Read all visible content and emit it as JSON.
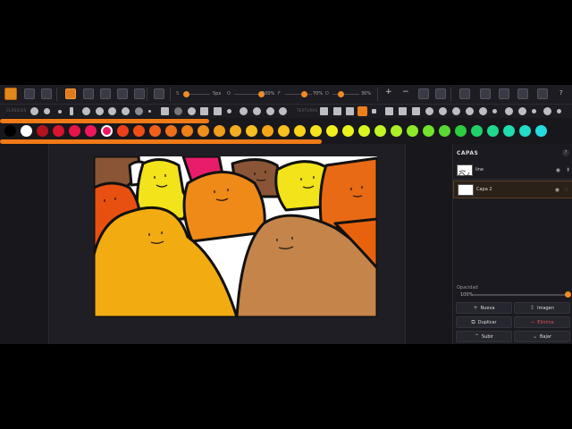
{
  "toolbar": {
    "sliders": [
      {
        "label": "S",
        "value": "5px",
        "fill": 0.1
      },
      {
        "label": "O",
        "value": "100%",
        "fill": 1.0
      },
      {
        "label": "F",
        "value": "70%",
        "fill": 0.7
      },
      {
        "label": "D",
        "value": "30%",
        "fill": 0.3
      }
    ],
    "help": "?"
  },
  "brushbar": {
    "section_brushes": "CLÁSICOS",
    "section_textures": "TEXTURAS",
    "accent": "#f07a16"
  },
  "palette": {
    "colors": [
      "#000000",
      "#ffffff",
      "#b3121c",
      "#d8142f",
      "#e8134a",
      "#f0165e",
      "#f01860",
      "#ef3f1a",
      "#ef4e14",
      "#f0601a",
      "#f0701a",
      "#f07f16",
      "#f08f1c",
      "#f29c1c",
      "#f4ac20",
      "#f7be24",
      "#f5a418",
      "#f7bf20",
      "#f7d218",
      "#f6e21c",
      "#f3ee1e",
      "#eaf31c",
      "#d7f51e",
      "#c2f326",
      "#aaf028",
      "#8ee82a",
      "#74e22c",
      "#5ad834",
      "#2ecc40",
      "#22d06a",
      "#20d88e",
      "#20dcae",
      "#22dcc8",
      "#24dce0"
    ],
    "selected_index": 6
  },
  "panel": {
    "title": "CAPAS",
    "help": "?",
    "layers": [
      {
        "name": "line",
        "selected": false
      },
      {
        "name": "Capa 2",
        "selected": true
      }
    ],
    "opacity_label": "Opacidad",
    "opacity_value": "100%",
    "buttons": {
      "new": "Nueva",
      "image": "Imagen",
      "duplicate": "Duplicar",
      "delete": "Elimina",
      "up": "Subir",
      "down": "Bajar"
    }
  }
}
